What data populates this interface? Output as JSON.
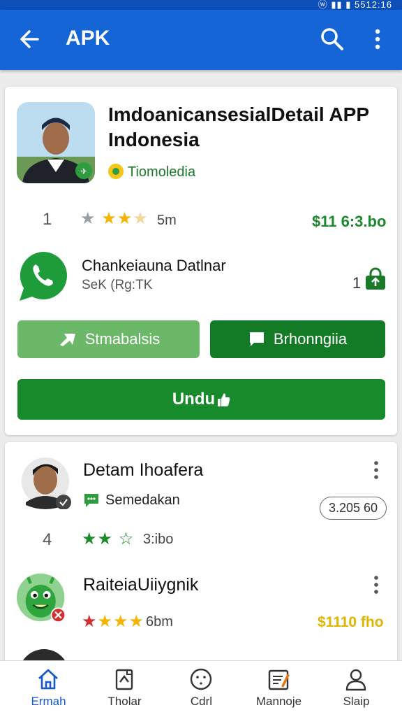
{
  "status_bar": {
    "text": "ⓦ ▮▮ ▮ 5512:16"
  },
  "app_bar": {
    "title": "APK"
  },
  "featured": {
    "title": "ImdoanicansesialDetail APP Indonesia",
    "developer": "Tiomoledia",
    "rank": "1",
    "rating_stars": 3,
    "rating_count": "5m",
    "price": "$11 6:3.bo",
    "related_app": {
      "name": "Chankeiauna Datlnar",
      "sub": "SeK (Rg:TK",
      "count": "1"
    },
    "btn_secondary": "Stmabalsis",
    "btn_tertiary": "Brhonngiia",
    "btn_primary": "Undu"
  },
  "list": [
    {
      "name": "Detam Ihoafera",
      "developer": "Semedakan",
      "rank": "4",
      "rating_stars": 2,
      "rating_count": "3:ibo",
      "size": "3.205 60"
    },
    {
      "name": "RaiteiaUiiygnik",
      "developer": "",
      "rank": "",
      "rating_stars": 4,
      "rating_count": "6bm",
      "price": "$1110 fho"
    }
  ],
  "bottom_nav": [
    {
      "label": "Ermah",
      "icon": "home-icon",
      "active": true
    },
    {
      "label": "Tholar",
      "icon": "document-icon"
    },
    {
      "label": "Cdrl",
      "icon": "smiley-icon"
    },
    {
      "label": "Mannoje",
      "icon": "manage-icon"
    },
    {
      "label": "Slaip",
      "icon": "person-icon"
    }
  ],
  "colors": {
    "app_bar": "#1565d6",
    "primary_green": "#178a2b",
    "light_green": "#6cb869",
    "price_green": "#1b8a2c",
    "star_gold": "#f4b400"
  }
}
